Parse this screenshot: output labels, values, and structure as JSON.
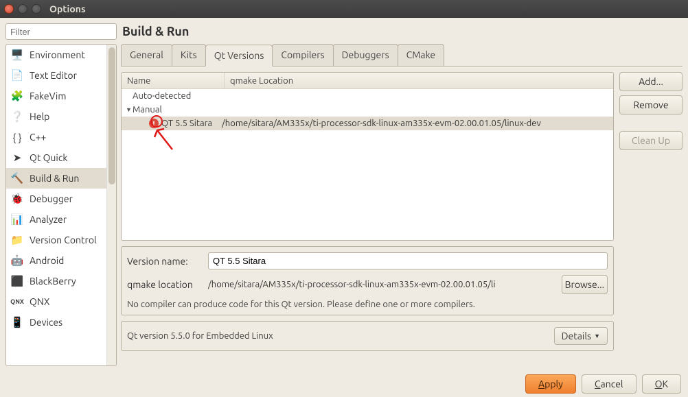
{
  "window": {
    "title": "Options"
  },
  "sidebar": {
    "filter_placeholder": "Filter",
    "items": [
      {
        "label": "Environment"
      },
      {
        "label": "Text Editor"
      },
      {
        "label": "FakeVim"
      },
      {
        "label": "Help"
      },
      {
        "label": "C++"
      },
      {
        "label": "Qt Quick"
      },
      {
        "label": "Build & Run"
      },
      {
        "label": "Debugger"
      },
      {
        "label": "Analyzer"
      },
      {
        "label": "Version Control"
      },
      {
        "label": "Android"
      },
      {
        "label": "BlackBerry"
      },
      {
        "label": "QNX"
      },
      {
        "label": "Devices"
      }
    ]
  },
  "main": {
    "title": "Build & Run",
    "tabs": [
      {
        "label": "General"
      },
      {
        "label": "Kits"
      },
      {
        "label": "Qt Versions"
      },
      {
        "label": "Compilers"
      },
      {
        "label": "Debuggers"
      },
      {
        "label": "CMake"
      }
    ],
    "tree": {
      "col_name": "Name",
      "col_loc": "qmake Location",
      "groups": {
        "auto": "Auto-detected",
        "manual": "Manual"
      },
      "row": {
        "name": "QT 5.5 Sitara",
        "location": "/home/sitara/AM335x/ti-processor-sdk-linux-am335x-evm-02.00.01.05/linux-dev"
      }
    },
    "buttons": {
      "add": "Add...",
      "remove": "Remove",
      "cleanup": "Clean Up"
    },
    "form": {
      "version_name_lbl": "Version name:",
      "version_name_val": "QT 5.5 Sitara",
      "qmake_loc_lbl": "qmake location",
      "qmake_loc_val": "/home/sitara/AM335x/ti-processor-sdk-linux-am335x-evm-02.00.01.05/li",
      "browse": "Browse...",
      "warn": "No compiler can produce code for this Qt version. Please define one or more compilers."
    },
    "version_info": "Qt version 5.5.0 for Embedded Linux",
    "details": "Details"
  },
  "footer": {
    "apply": "Apply",
    "cancel": "Cancel",
    "ok": "OK"
  }
}
